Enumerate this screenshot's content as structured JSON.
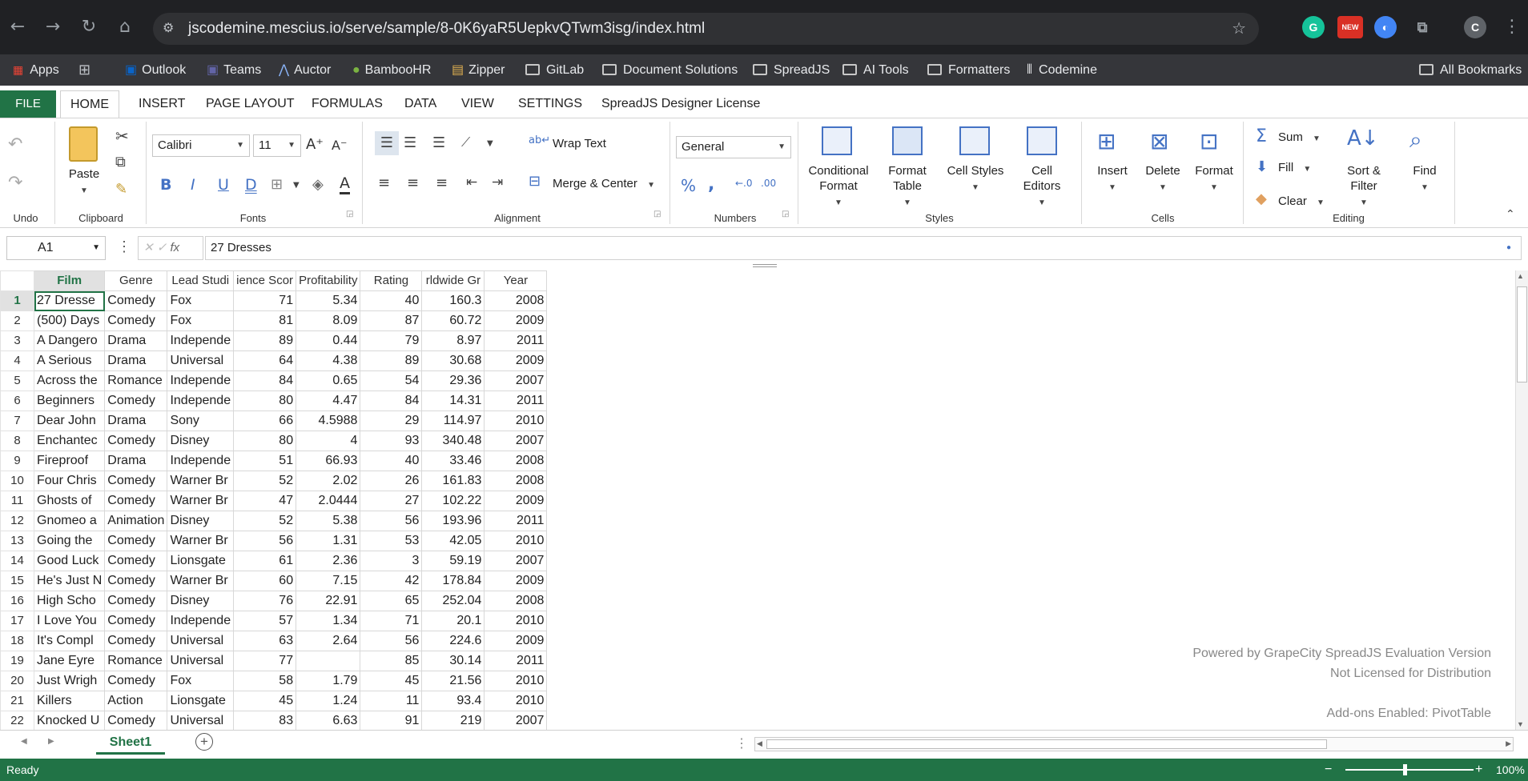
{
  "browser": {
    "url": "jscodemine.mescius.io/serve/sample/8-0K6yaR5UepkvQTwm3isg/index.html",
    "ext_new_badge": "NEW",
    "profile_initial": "C",
    "bookmarks": [
      "Apps",
      "Outlook",
      "Teams",
      "Auctor",
      "BambooHR",
      "Zipper",
      "GitLab",
      "Document Solutions",
      "SpreadJS",
      "AI Tools",
      "Formatters",
      "Codemine"
    ],
    "all_bookmarks": "All Bookmarks"
  },
  "ribbon": {
    "tabs": [
      "FILE",
      "HOME",
      "INSERT",
      "PAGE LAYOUT",
      "FORMULAS",
      "DATA",
      "VIEW",
      "SETTINGS",
      "SpreadJS Designer License"
    ],
    "groups": [
      "Undo",
      "Clipboard",
      "Fonts",
      "Alignment",
      "Numbers",
      "Styles",
      "Cells",
      "Editing"
    ],
    "paste": "Paste",
    "font_name": "Calibri",
    "font_size": "11",
    "wrap_text": "Wrap Text",
    "merge_center": "Merge & Center",
    "number_format": "General",
    "conditional_format": [
      "Conditional",
      "Format"
    ],
    "format_table": [
      "Format",
      "Table"
    ],
    "cell_styles": "Cell Styles",
    "cell_editors": [
      "Cell",
      "Editors"
    ],
    "insert": "Insert",
    "delete": "Delete",
    "format": "Format",
    "sum": "Sum",
    "fill": "Fill",
    "clear": "Clear",
    "sort_filter": [
      "Sort &",
      "Filter"
    ],
    "find": "Find"
  },
  "formula": {
    "cell_ref": "A1",
    "fx": "fx",
    "value": "27 Dresses"
  },
  "grid": {
    "headers": [
      "Film",
      "Genre",
      "Lead Studio",
      "Audience Score",
      "Profitability",
      "Rating",
      "Worldwide Gross",
      "Year"
    ],
    "header_display": [
      "Film",
      "Genre",
      "Lead Studi",
      "ience Scor",
      "Profitability",
      "Rating",
      "rldwide Gr",
      "Year"
    ],
    "rows": [
      [
        "27 Dresse",
        "Comedy",
        "Fox",
        "71",
        "5.34",
        "40",
        "160.3",
        "2008"
      ],
      [
        "(500) Days",
        "Comedy",
        "Fox",
        "81",
        "8.09",
        "87",
        "60.72",
        "2009"
      ],
      [
        "A Dangero",
        "Drama",
        "Independe",
        "89",
        "0.44",
        "79",
        "8.97",
        "2011"
      ],
      [
        "A Serious",
        "Drama",
        "Universal",
        "64",
        "4.38",
        "89",
        "30.68",
        "2009"
      ],
      [
        "Across the",
        "Romance",
        "Independe",
        "84",
        "0.65",
        "54",
        "29.36",
        "2007"
      ],
      [
        "Beginners",
        "Comedy",
        "Independe",
        "80",
        "4.47",
        "84",
        "14.31",
        "2011"
      ],
      [
        "Dear John",
        "Drama",
        "Sony",
        "66",
        "4.5988",
        "29",
        "114.97",
        "2010"
      ],
      [
        "Enchantec",
        "Comedy",
        "Disney",
        "80",
        "4",
        "93",
        "340.48",
        "2007"
      ],
      [
        "Fireproof",
        "Drama",
        "Independe",
        "51",
        "66.93",
        "40",
        "33.46",
        "2008"
      ],
      [
        "Four Chris",
        "Comedy",
        "Warner Br",
        "52",
        "2.02",
        "26",
        "161.83",
        "2008"
      ],
      [
        "Ghosts of",
        "Comedy",
        "Warner Br",
        "47",
        "2.0444",
        "27",
        "102.22",
        "2009"
      ],
      [
        "Gnomeo a",
        "Animation",
        "Disney",
        "52",
        "5.38",
        "56",
        "193.96",
        "2011"
      ],
      [
        "Going the",
        "Comedy",
        "Warner Br",
        "56",
        "1.31",
        "53",
        "42.05",
        "2010"
      ],
      [
        "Good Luck",
        "Comedy",
        "Lionsgate",
        "61",
        "2.36",
        "3",
        "59.19",
        "2007"
      ],
      [
        "He's Just N",
        "Comedy",
        "Warner Br",
        "60",
        "7.15",
        "42",
        "178.84",
        "2009"
      ],
      [
        "High Scho",
        "Comedy",
        "Disney",
        "76",
        "22.91",
        "65",
        "252.04",
        "2008"
      ],
      [
        "I Love You",
        "Comedy",
        "Independe",
        "57",
        "1.34",
        "71",
        "20.1",
        "2010"
      ],
      [
        "It's Compl",
        "Comedy",
        "Universal",
        "63",
        "2.64",
        "56",
        "224.6",
        "2009"
      ],
      [
        "Jane Eyre",
        "Romance",
        "Universal",
        "77",
        "",
        "85",
        "30.14",
        "2011"
      ],
      [
        "Just Wrigh",
        "Comedy",
        "Fox",
        "58",
        "1.79",
        "45",
        "21.56",
        "2010"
      ],
      [
        "Killers",
        "Action",
        "Lionsgate",
        "45",
        "1.24",
        "11",
        "93.4",
        "2010"
      ],
      [
        "Knocked U",
        "Comedy",
        "Universal",
        "83",
        "6.63",
        "91",
        "219",
        "2007"
      ]
    ]
  },
  "watermark": {
    "line1": "Powered by GrapeCity SpreadJS Evaluation Version",
    "line2": "Not Licensed for Distribution",
    "line3": "Add-ons Enabled: PivotTable"
  },
  "sheet_tab": "Sheet1",
  "status": {
    "left": "Ready",
    "zoom": "100%"
  }
}
